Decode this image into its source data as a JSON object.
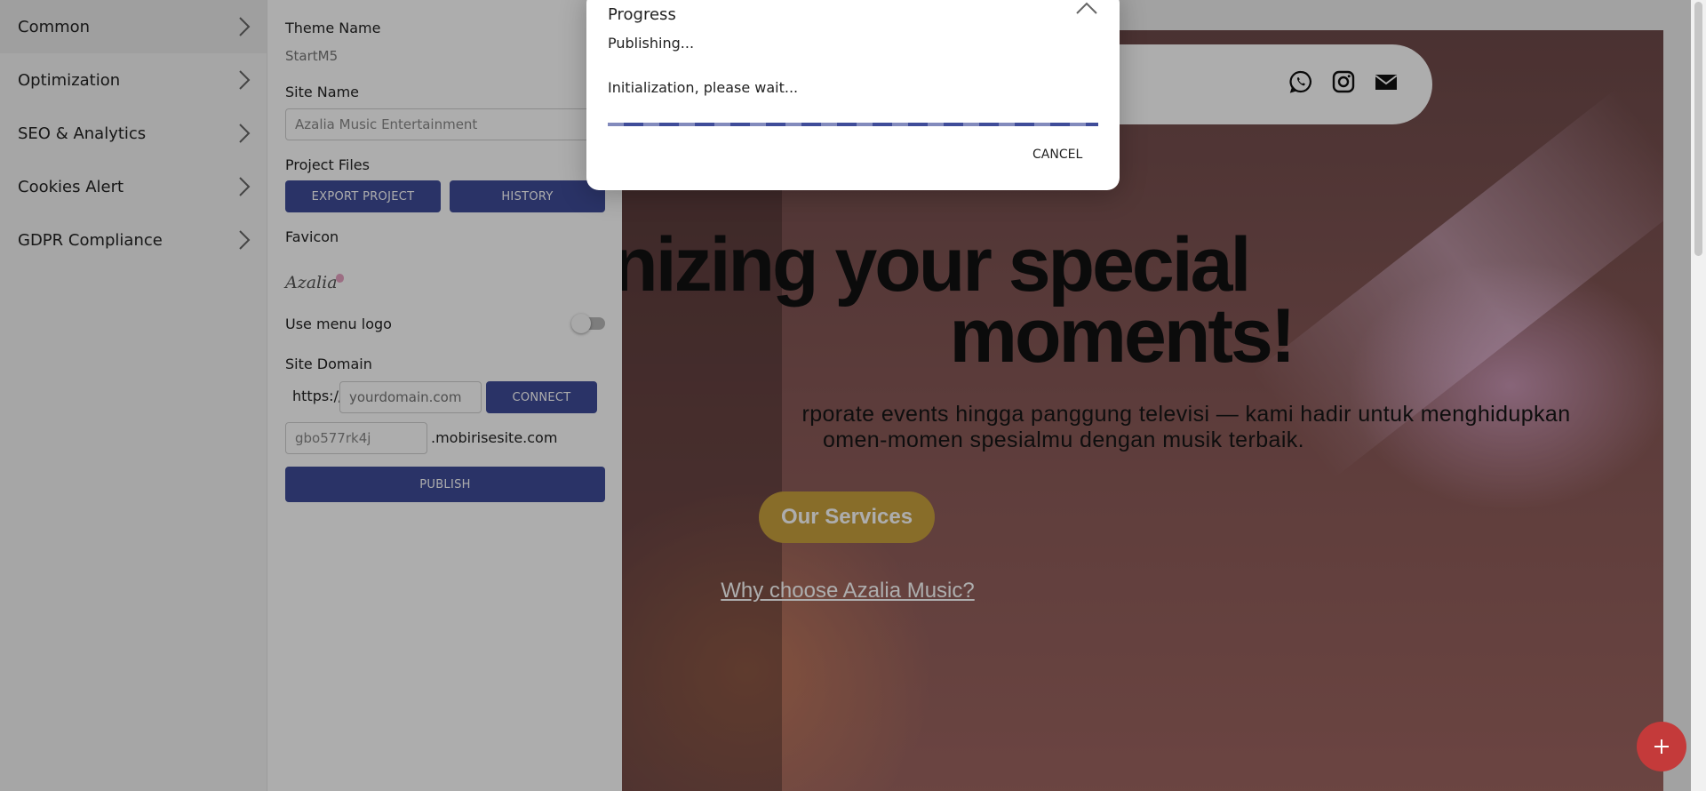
{
  "nav": {
    "items": [
      {
        "label": "Common",
        "icon": "chevron-right-icon"
      },
      {
        "label": "Optimization",
        "icon": "chevron-right-icon"
      },
      {
        "label": "SEO & Analytics",
        "icon": "chevron-right-icon"
      },
      {
        "label": "Cookies Alert",
        "icon": "chevron-right-icon"
      },
      {
        "label": "GDPR Compliance",
        "icon": "chevron-right-icon"
      }
    ]
  },
  "panel": {
    "theme_name_label": "Theme Name",
    "theme_name_value": "StartM5",
    "site_name_label": "Site Name",
    "site_name_value": "Azalia Music Entertainment",
    "project_files_label": "Project Files",
    "export_button": "EXPORT PROJECT",
    "history_button": "HISTORY",
    "favicon_label": "Favicon",
    "favicon_text": "Azalia",
    "use_menu_logo_label": "Use menu logo",
    "use_menu_logo_on": false,
    "site_domain_label": "Site Domain",
    "https_prefix": "https://",
    "domain_placeholder": "yourdomain.com",
    "connect_button": "CONNECT",
    "subdomain_value": "gbo577rk4j",
    "subdomain_suffix": ".mobirisesite.com",
    "publish_button": "PUBLISH"
  },
  "preview": {
    "headline_line1": "onizing your special",
    "headline_line2": "moments!",
    "sub_line1": "rporate events hingga panggung televisi — kami hadir untuk menghidupkan",
    "sub_line2": "omen-momen spesialmu dengan musik terbaik.",
    "cta_button": "Our Services",
    "why_link": "Why choose Azalia Music?",
    "social_icons": [
      "whatsapp-icon",
      "instagram-icon",
      "mail-icon"
    ],
    "accent_gold": "#c9a13d"
  },
  "dialog": {
    "title": "Progress",
    "status": "Publishing...",
    "message": "Initialization, please wait...",
    "cancel_button": "CANCEL",
    "progress_color": "#3f4c99"
  },
  "fab_icon": "plus-icon"
}
